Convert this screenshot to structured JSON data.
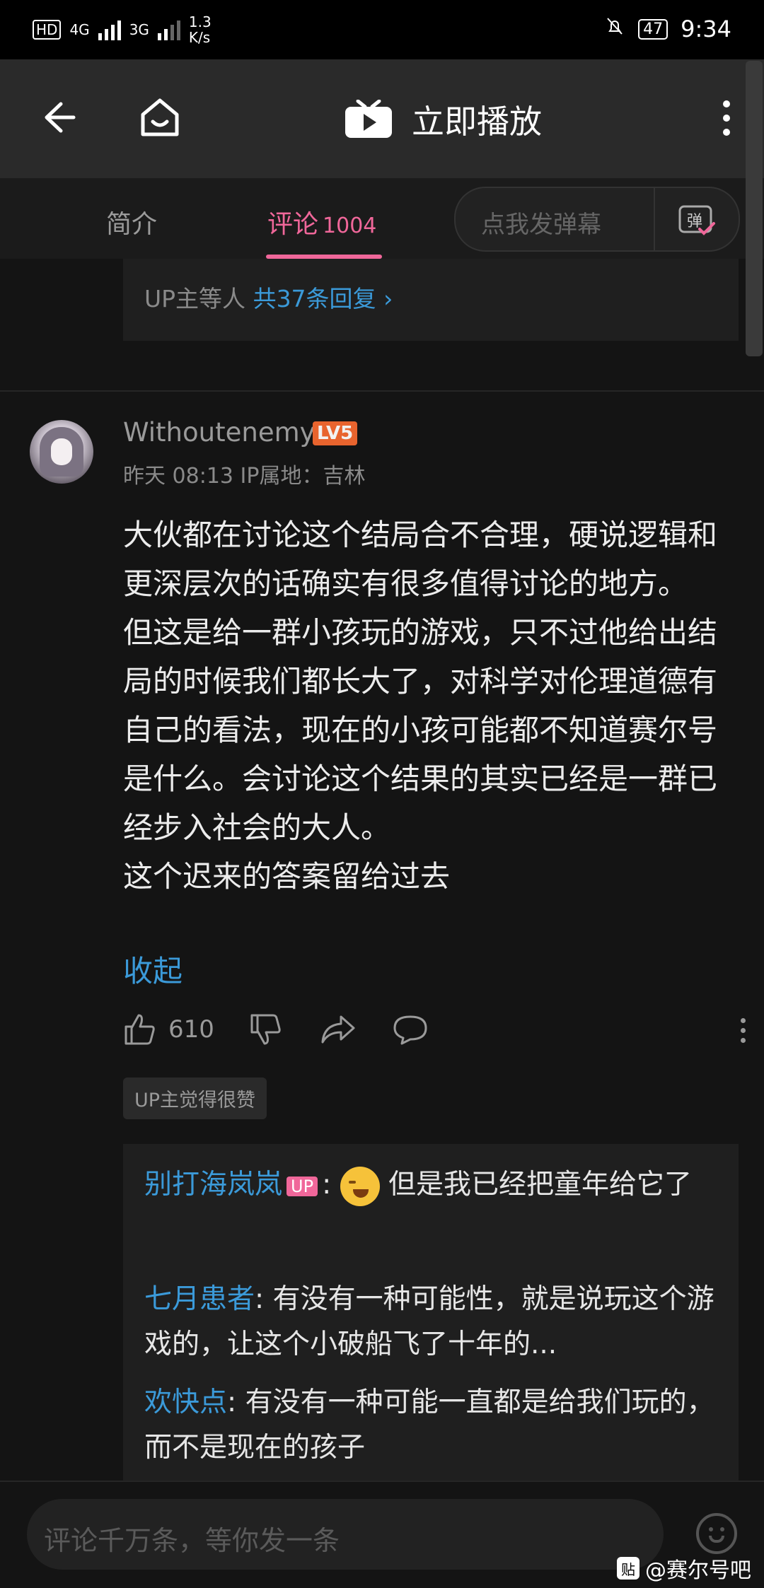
{
  "status_bar": {
    "hd_label": "HD",
    "sim1_network": "4G",
    "sim2_network": "3G",
    "net_speed_value": "1.3",
    "net_speed_unit": "K/s",
    "battery": "47",
    "time": "9:34"
  },
  "header": {
    "title": "立即播放"
  },
  "tabs": {
    "intro": "简介",
    "comment": "评论",
    "comment_count": "1004",
    "danmu_placeholder": "点我发弹幕",
    "danmu_button": "弹"
  },
  "prev_reply_summary": {
    "prefix": "UP主等人",
    "link": "共37条回复"
  },
  "comment": {
    "username": "Withoutenemy",
    "level": "LV5",
    "meta": "昨天 08:13  IP属地：吉林",
    "paragraphs": [
      "大伙都在讨论这个结局合不合理，硬说逻辑和更深层次的话确实有很多值得讨论的地方。",
      "但这是给一群小孩玩的游戏，只不过他给出结局的时候我们都长大了，对科学对伦理道德有自己的看法，现在的小孩可能都不知道赛尔号是什么。会讨论这个结果的其实已经是一群已经步入社会的大人。",
      "这个迟来的答案留给过去"
    ],
    "collapse": "收起",
    "like_count": "610",
    "up_badge": "UP主觉得很赞"
  },
  "replies": [
    {
      "name": "别打海岚岚",
      "up_tag": "UP",
      "text": "但是我已经把童年给它了"
    },
    {
      "name": "七月患者",
      "text": "有没有一种可能性，就是说玩这个游戏的，让这个小破船飞了十年的..."
    },
    {
      "name": "欢快点",
      "text": "有没有一种可能一直都是给我们玩的，而不是现在的孩子"
    }
  ],
  "bottom": {
    "input_placeholder": "评论千万条，等你发一条"
  },
  "watermark": {
    "logo": "贴",
    "text": "@赛尔号吧"
  },
  "colors": {
    "accent_pink": "#f0679a",
    "link_blue": "#3b9ad9",
    "background": "#141414"
  }
}
